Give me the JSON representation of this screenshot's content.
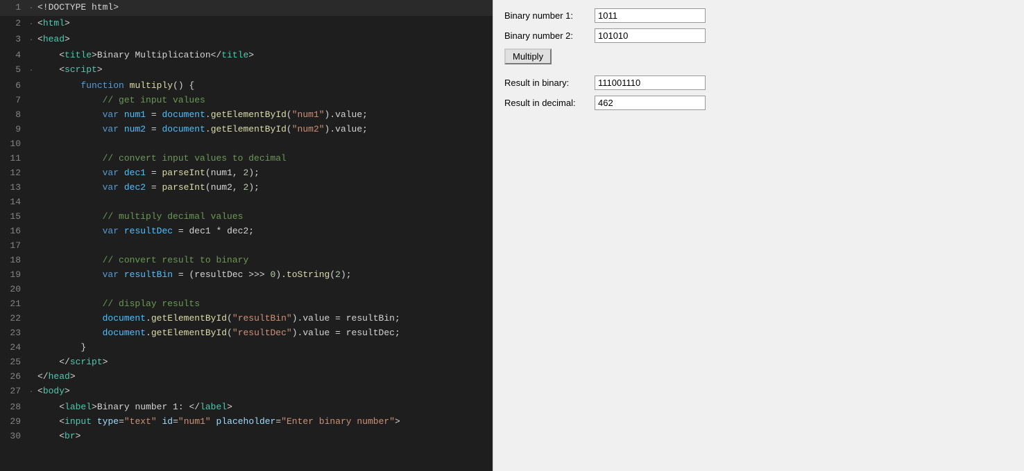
{
  "editor": {
    "lines": [
      {
        "num": 1,
        "dot": "-",
        "tokens": [
          {
            "text": "<!DOCTYPE html>",
            "cls": "c-white"
          }
        ]
      },
      {
        "num": 2,
        "dot": "-",
        "tokens": [
          {
            "text": "<",
            "cls": "c-white"
          },
          {
            "text": "html",
            "cls": "c-tag-name"
          },
          {
            "text": ">",
            "cls": "c-white"
          }
        ]
      },
      {
        "num": 3,
        "dot": "-",
        "tokens": [
          {
            "text": "<",
            "cls": "c-white"
          },
          {
            "text": "head",
            "cls": "c-tag-name"
          },
          {
            "text": ">",
            "cls": "c-white"
          }
        ]
      },
      {
        "num": 4,
        "dot": " ",
        "tokens": [
          {
            "text": "    <",
            "cls": "c-white"
          },
          {
            "text": "title",
            "cls": "c-tag-name"
          },
          {
            "text": ">Binary Multiplication</",
            "cls": "c-white"
          },
          {
            "text": "title",
            "cls": "c-tag-name"
          },
          {
            "text": ">",
            "cls": "c-white"
          }
        ]
      },
      {
        "num": 5,
        "dot": "-",
        "tokens": [
          {
            "text": "    <",
            "cls": "c-white"
          },
          {
            "text": "script",
            "cls": "c-tag-name"
          },
          {
            "text": ">",
            "cls": "c-white"
          }
        ]
      },
      {
        "num": 6,
        "dot": " ",
        "tokens": [
          {
            "text": "        ",
            "cls": "c-white"
          },
          {
            "text": "function ",
            "cls": "c-blue"
          },
          {
            "text": "multiply",
            "cls": "c-yellow"
          },
          {
            "text": "() {",
            "cls": "c-white"
          }
        ]
      },
      {
        "num": 7,
        "dot": " ",
        "tokens": [
          {
            "text": "            // get input values",
            "cls": "c-green"
          }
        ]
      },
      {
        "num": 8,
        "dot": " ",
        "tokens": [
          {
            "text": "            ",
            "cls": "c-white"
          },
          {
            "text": "var ",
            "cls": "c-blue"
          },
          {
            "text": "num1",
            "cls": "c-cyan"
          },
          {
            "text": " = ",
            "cls": "c-white"
          },
          {
            "text": "document",
            "cls": "c-cyan"
          },
          {
            "text": ".",
            "cls": "c-white"
          },
          {
            "text": "getElementById",
            "cls": "c-yellow"
          },
          {
            "text": "(",
            "cls": "c-white"
          },
          {
            "text": "\"num1\"",
            "cls": "c-str-dq"
          },
          {
            "text": ").value;",
            "cls": "c-white"
          }
        ]
      },
      {
        "num": 9,
        "dot": " ",
        "tokens": [
          {
            "text": "            ",
            "cls": "c-white"
          },
          {
            "text": "var ",
            "cls": "c-blue"
          },
          {
            "text": "num2",
            "cls": "c-cyan"
          },
          {
            "text": " = ",
            "cls": "c-white"
          },
          {
            "text": "document",
            "cls": "c-cyan"
          },
          {
            "text": ".",
            "cls": "c-white"
          },
          {
            "text": "getElementById",
            "cls": "c-yellow"
          },
          {
            "text": "(",
            "cls": "c-white"
          },
          {
            "text": "\"num2\"",
            "cls": "c-str-dq"
          },
          {
            "text": ").value;",
            "cls": "c-white"
          }
        ]
      },
      {
        "num": 10,
        "dot": " ",
        "tokens": [
          {
            "text": "",
            "cls": "c-white"
          }
        ]
      },
      {
        "num": 11,
        "dot": " ",
        "tokens": [
          {
            "text": "            // convert input values to decimal",
            "cls": "c-green"
          }
        ]
      },
      {
        "num": 12,
        "dot": " ",
        "tokens": [
          {
            "text": "            ",
            "cls": "c-white"
          },
          {
            "text": "var ",
            "cls": "c-blue"
          },
          {
            "text": "dec1",
            "cls": "c-cyan"
          },
          {
            "text": " = ",
            "cls": "c-white"
          },
          {
            "text": "parseInt",
            "cls": "c-yellow"
          },
          {
            "text": "(num1, ",
            "cls": "c-white"
          },
          {
            "text": "2",
            "cls": "c-num"
          },
          {
            "text": ");",
            "cls": "c-white"
          }
        ]
      },
      {
        "num": 13,
        "dot": " ",
        "tokens": [
          {
            "text": "            ",
            "cls": "c-white"
          },
          {
            "text": "var ",
            "cls": "c-blue"
          },
          {
            "text": "dec2",
            "cls": "c-cyan"
          },
          {
            "text": " = ",
            "cls": "c-white"
          },
          {
            "text": "parseInt",
            "cls": "c-yellow"
          },
          {
            "text": "(num2, ",
            "cls": "c-white"
          },
          {
            "text": "2",
            "cls": "c-num"
          },
          {
            "text": ");",
            "cls": "c-white"
          }
        ]
      },
      {
        "num": 14,
        "dot": " ",
        "tokens": [
          {
            "text": "",
            "cls": "c-white"
          }
        ]
      },
      {
        "num": 15,
        "dot": " ",
        "tokens": [
          {
            "text": "            // multiply decimal values",
            "cls": "c-green"
          }
        ]
      },
      {
        "num": 16,
        "dot": " ",
        "tokens": [
          {
            "text": "            ",
            "cls": "c-white"
          },
          {
            "text": "var ",
            "cls": "c-blue"
          },
          {
            "text": "resultDec",
            "cls": "c-cyan"
          },
          {
            "text": " = dec1 * dec2;",
            "cls": "c-white"
          }
        ]
      },
      {
        "num": 17,
        "dot": " ",
        "tokens": [
          {
            "text": "",
            "cls": "c-white"
          }
        ]
      },
      {
        "num": 18,
        "dot": " ",
        "tokens": [
          {
            "text": "            // convert result to binary",
            "cls": "c-green"
          }
        ]
      },
      {
        "num": 19,
        "dot": " ",
        "tokens": [
          {
            "text": "            ",
            "cls": "c-white"
          },
          {
            "text": "var ",
            "cls": "c-blue"
          },
          {
            "text": "resultBin",
            "cls": "c-cyan"
          },
          {
            "text": " = (resultDec >>> ",
            "cls": "c-white"
          },
          {
            "text": "0",
            "cls": "c-num"
          },
          {
            "text": ").",
            "cls": "c-white"
          },
          {
            "text": "toString",
            "cls": "c-yellow"
          },
          {
            "text": "(",
            "cls": "c-white"
          },
          {
            "text": "2",
            "cls": "c-num"
          },
          {
            "text": ");",
            "cls": "c-white"
          }
        ]
      },
      {
        "num": 20,
        "dot": " ",
        "tokens": [
          {
            "text": "",
            "cls": "c-white"
          }
        ]
      },
      {
        "num": 21,
        "dot": " ",
        "tokens": [
          {
            "text": "            // display results",
            "cls": "c-green"
          }
        ]
      },
      {
        "num": 22,
        "dot": " ",
        "tokens": [
          {
            "text": "            ",
            "cls": "c-white"
          },
          {
            "text": "document",
            "cls": "c-cyan"
          },
          {
            "text": ".",
            "cls": "c-white"
          },
          {
            "text": "getElementById",
            "cls": "c-yellow"
          },
          {
            "text": "(",
            "cls": "c-white"
          },
          {
            "text": "\"resultBin\"",
            "cls": "c-str-dq"
          },
          {
            "text": ").value = resultBin;",
            "cls": "c-white"
          }
        ]
      },
      {
        "num": 23,
        "dot": " ",
        "tokens": [
          {
            "text": "            ",
            "cls": "c-white"
          },
          {
            "text": "document",
            "cls": "c-cyan"
          },
          {
            "text": ".",
            "cls": "c-white"
          },
          {
            "text": "getElementById",
            "cls": "c-yellow"
          },
          {
            "text": "(",
            "cls": "c-white"
          },
          {
            "text": "\"resultDec\"",
            "cls": "c-str-dq"
          },
          {
            "text": ").value = resultDec;",
            "cls": "c-white"
          }
        ]
      },
      {
        "num": 24,
        "dot": " ",
        "tokens": [
          {
            "text": "        }",
            "cls": "c-white"
          }
        ]
      },
      {
        "num": 25,
        "dot": " ",
        "tokens": [
          {
            "text": "    </",
            "cls": "c-white"
          },
          {
            "text": "script",
            "cls": "c-tag-name"
          },
          {
            "text": ">",
            "cls": "c-white"
          }
        ]
      },
      {
        "num": 26,
        "dot": " ",
        "tokens": [
          {
            "text": "</",
            "cls": "c-white"
          },
          {
            "text": "head",
            "cls": "c-tag-name"
          },
          {
            "text": ">",
            "cls": "c-white"
          }
        ]
      },
      {
        "num": 27,
        "dot": "-",
        "tokens": [
          {
            "text": "<",
            "cls": "c-white"
          },
          {
            "text": "body",
            "cls": "c-tag-name"
          },
          {
            "text": ">",
            "cls": "c-white"
          }
        ]
      },
      {
        "num": 28,
        "dot": " ",
        "tokens": [
          {
            "text": "    <",
            "cls": "c-white"
          },
          {
            "text": "label",
            "cls": "c-tag-name"
          },
          {
            "text": ">Binary number 1: </",
            "cls": "c-white"
          },
          {
            "text": "label",
            "cls": "c-tag-name"
          },
          {
            "text": ">",
            "cls": "c-white"
          }
        ]
      },
      {
        "num": 29,
        "dot": " ",
        "tokens": [
          {
            "text": "    <",
            "cls": "c-white"
          },
          {
            "text": "input",
            "cls": "c-tag-name"
          },
          {
            "text": " ",
            "cls": "c-white"
          },
          {
            "text": "type",
            "cls": "c-attr"
          },
          {
            "text": "=",
            "cls": "c-white"
          },
          {
            "text": "\"text\"",
            "cls": "c-str-dq"
          },
          {
            "text": " ",
            "cls": "c-white"
          },
          {
            "text": "id",
            "cls": "c-attr"
          },
          {
            "text": "=",
            "cls": "c-white"
          },
          {
            "text": "\"num1\"",
            "cls": "c-str-dq"
          },
          {
            "text": " ",
            "cls": "c-white"
          },
          {
            "text": "placeholder",
            "cls": "c-attr"
          },
          {
            "text": "=",
            "cls": "c-white"
          },
          {
            "text": "\"Enter binary number\"",
            "cls": "c-str-dq"
          },
          {
            "text": ">",
            "cls": "c-white"
          }
        ]
      },
      {
        "num": 30,
        "dot": " ",
        "tokens": [
          {
            "text": "    <",
            "cls": "c-white"
          },
          {
            "text": "br",
            "cls": "c-tag-name"
          },
          {
            "text": ">",
            "cls": "c-white"
          }
        ]
      }
    ]
  },
  "preview": {
    "binary1_label": "Binary number 1:",
    "binary2_label": "Binary number 2:",
    "binary1_value": "1011",
    "binary2_value": "101010",
    "multiply_btn": "Multiply",
    "result_binary_label": "Result in binary:",
    "result_decimal_label": "Result in decimal:",
    "result_binary_value": "111001110",
    "result_decimal_value": "462"
  }
}
